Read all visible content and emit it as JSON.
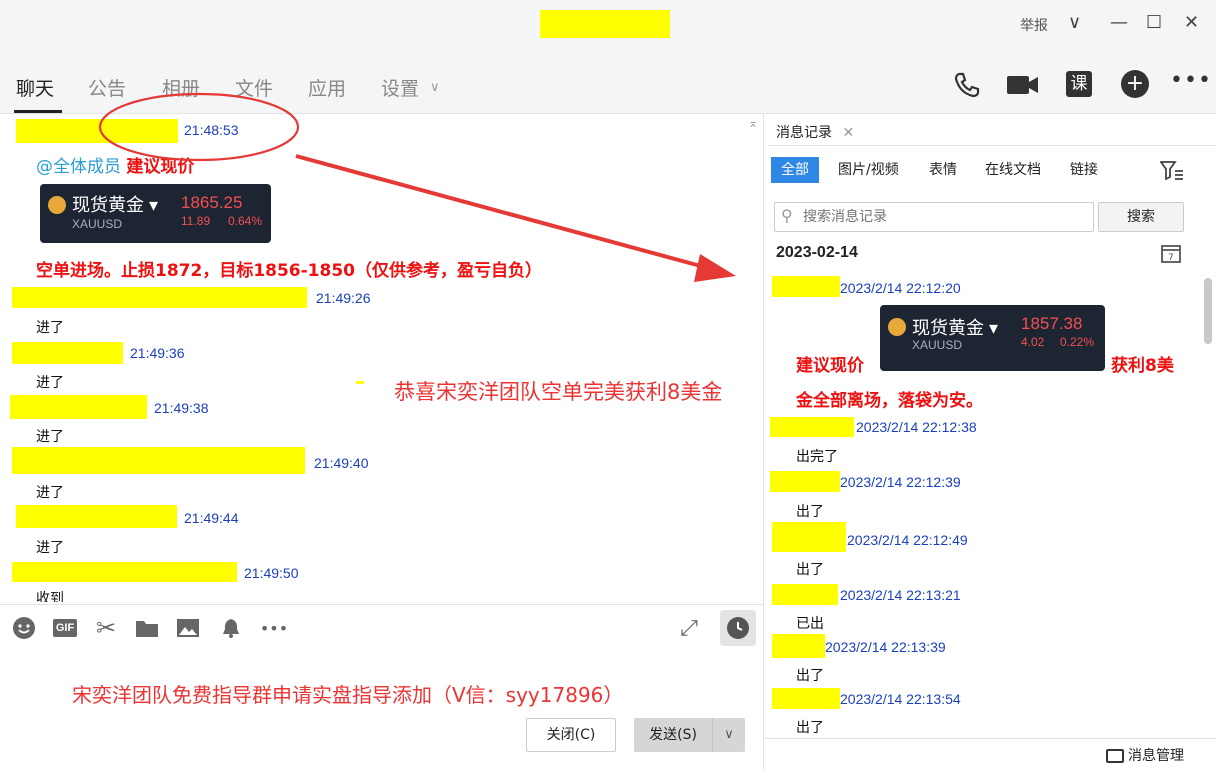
{
  "window": {
    "report_label": "举报",
    "controls": {
      "collapse": "∨",
      "minimize": "—",
      "maximize": "☐",
      "close": "✕"
    }
  },
  "tabs": [
    "聊天",
    "公告",
    "相册",
    "文件",
    "应用",
    "设置"
  ],
  "header_icons": {
    "course_label": "课"
  },
  "chat": {
    "first": {
      "time": "21:48:53",
      "mention": "@全体成员",
      "highlight": "建议现价",
      "quote": {
        "name": "现货黄金",
        "symbol": "XAUUSD",
        "price": "1865.25",
        "change": "11.89",
        "change_pct": "0.64%"
      },
      "strategy": "空单进场。止损1872，目标1856-1850（仅供参考，盈亏自负）"
    },
    "messages": [
      {
        "time": "21:49:26",
        "text": "进了"
      },
      {
        "time": "21:49:36",
        "text": "进了"
      },
      {
        "time": "21:49:38",
        "text": "进了"
      },
      {
        "time": "21:49:40",
        "text": "进了"
      },
      {
        "time": "21:49:44",
        "text": "进了"
      },
      {
        "time": "21:49:50",
        "text": "收到"
      }
    ],
    "overlay_congrats": "恭喜宋奕洋团队空单完美获利8美金"
  },
  "compose": {
    "overlay_ad": "宋奕洋团队免费指导群申请实盘指导添加（V信：syy17896）",
    "close_button": "关闭(C)",
    "send_button": "发送(S)"
  },
  "history": {
    "tab_label": "消息记录",
    "filters": [
      "全部",
      "图片/视频",
      "表情",
      "在线文档",
      "链接"
    ],
    "search_placeholder": "搜索消息记录",
    "search_button": "搜索",
    "date": "2023-02-14",
    "first": {
      "time": "2023/2/14 22:12:20",
      "left_text": "建议现价",
      "right_text": "获利8美",
      "line2": "金全部离场，落袋为安。",
      "quote": {
        "name": "现货黄金",
        "symbol": "XAUUSD",
        "price": "1857.38",
        "change": "4.02",
        "change_pct": "0.22%"
      }
    },
    "messages": [
      {
        "time": "2023/2/14 22:12:38",
        "text": "出完了"
      },
      {
        "time": "2023/2/14 22:12:39",
        "text": "出了"
      },
      {
        "time": "2023/2/14 22:12:49",
        "text": "出了"
      },
      {
        "time": "2023/2/14 22:13:21",
        "text": "已出"
      },
      {
        "time": "2023/2/14 22:13:39",
        "text": "出了"
      },
      {
        "time": "2023/2/14 22:13:54",
        "text": "出了"
      }
    ],
    "manage_label": "消息管理"
  },
  "colors": {
    "accent": "#2f87e6",
    "highlight": "#ffff00",
    "timestamp": "#1a3fbf",
    "annotation": "#e53935"
  }
}
